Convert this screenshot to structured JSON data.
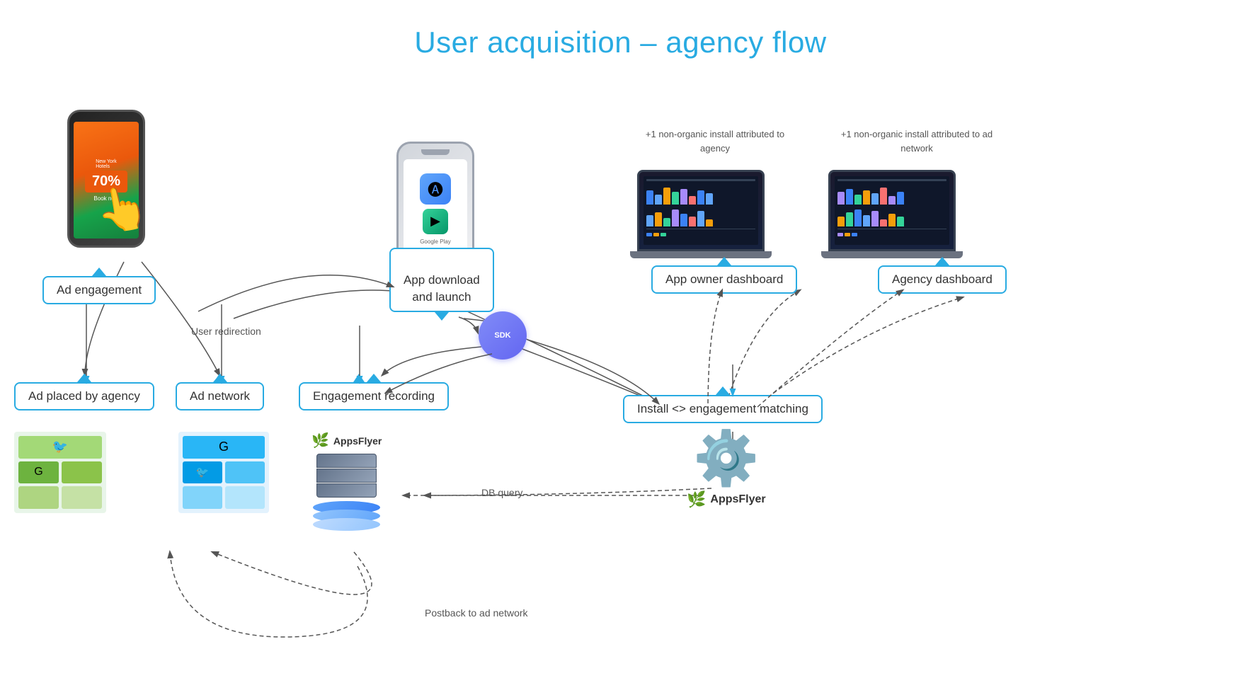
{
  "title": "User acquisition – agency flow",
  "callouts": {
    "ad_engagement": "Ad engagement",
    "app_download": "App download\nand launch",
    "ad_placed": "Ad placed by agency",
    "ad_network": "Ad network",
    "engagement_recording": "Engagement recording",
    "install_matching": "Install <> engagement matching",
    "app_owner_dashboard": "App owner dashboard",
    "agency_dashboard": "Agency dashboard"
  },
  "labels": {
    "user_redirection": "User redirection",
    "db_query": "DB query",
    "postback": "Postback to ad network",
    "non_organic_agency": "+1 non-organic install\nattributed to agency",
    "non_organic_adnetwork": "+1 non-organic install\nattributed to ad network"
  },
  "phone_screen": {
    "city": "New York\nHotels",
    "discount": "70%"
  },
  "sdk_label": "SDK",
  "appsflyer": "AppsFlyer",
  "colors": {
    "accent": "#29abe2",
    "dark": "#1e293b",
    "green": "#16a34a"
  }
}
